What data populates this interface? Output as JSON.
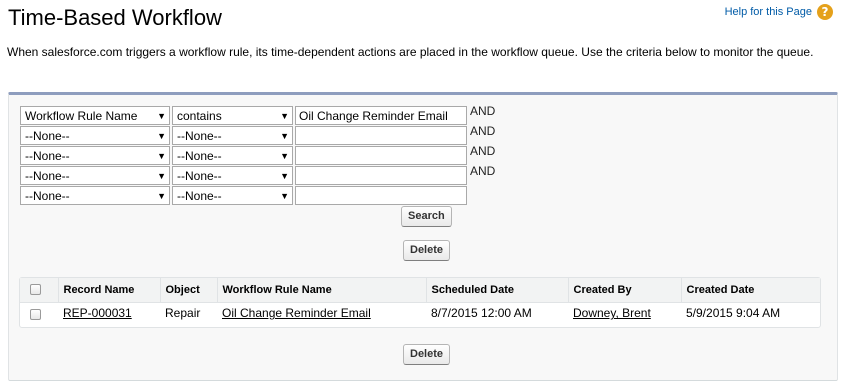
{
  "header": {
    "title": "Time-Based Workflow",
    "help_label": "Help for this Page",
    "help_icon": "question-icon"
  },
  "description": "When salesforce.com triggers a workflow rule, its time-dependent actions are placed in the workflow queue. Use the criteria below to monitor the queue.",
  "filters": [
    {
      "field": "Workflow Rule Name",
      "operator": "contains",
      "value": "Oil Change Reminder Email",
      "connector": "AND"
    },
    {
      "field": "--None--",
      "operator": "--None--",
      "value": "",
      "connector": "AND"
    },
    {
      "field": "--None--",
      "operator": "--None--",
      "value": "",
      "connector": "AND"
    },
    {
      "field": "--None--",
      "operator": "--None--",
      "value": "",
      "connector": "AND"
    },
    {
      "field": "--None--",
      "operator": "--None--",
      "value": "",
      "connector": ""
    }
  ],
  "buttons": {
    "search": "Search",
    "delete_top": "Delete",
    "delete_bottom": "Delete"
  },
  "table": {
    "columns": [
      "Record Name",
      "Object",
      "Workflow Rule Name",
      "Scheduled Date",
      "Created By",
      "Created Date"
    ],
    "rows": [
      {
        "record_name": "REP-000031",
        "object": "Repair",
        "workflow_rule_name": "Oil Change Reminder Email",
        "scheduled_date": "8/7/2015 12:00 AM",
        "created_by": "Downey, Brent",
        "created_date": "5/9/2015 9:04 AM"
      }
    ]
  },
  "colors": {
    "panel_border": "#8e9dbe",
    "help_icon": "#e5a11b",
    "link": "#015ba7"
  }
}
